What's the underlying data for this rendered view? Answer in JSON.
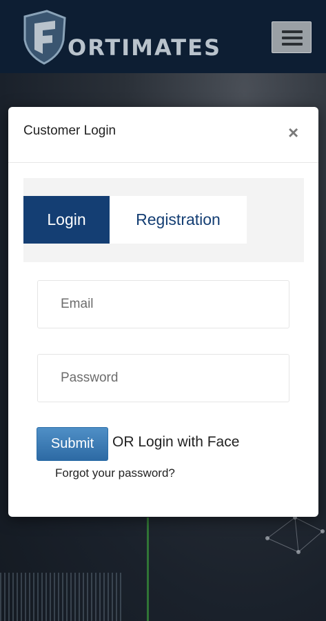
{
  "header": {
    "logo_text": "ORTIMATES",
    "menu_icon": "hamburger-icon",
    "colors": {
      "background": "#0d1e33",
      "logo": "#b9c3cc"
    }
  },
  "modal": {
    "title": "Customer Login",
    "close_icon": "close-icon",
    "tabs": [
      {
        "label": "Login",
        "active": true
      },
      {
        "label": "Registration",
        "active": false
      }
    ],
    "email": {
      "placeholder": "Email",
      "value": ""
    },
    "password": {
      "placeholder": "Password",
      "value": ""
    },
    "submit_label": "Submit",
    "face_login_text": "OR Login with Face",
    "forgot_label": "Forgot your password?",
    "colors": {
      "accent": "#143e73",
      "button": "#3b7db6"
    }
  }
}
